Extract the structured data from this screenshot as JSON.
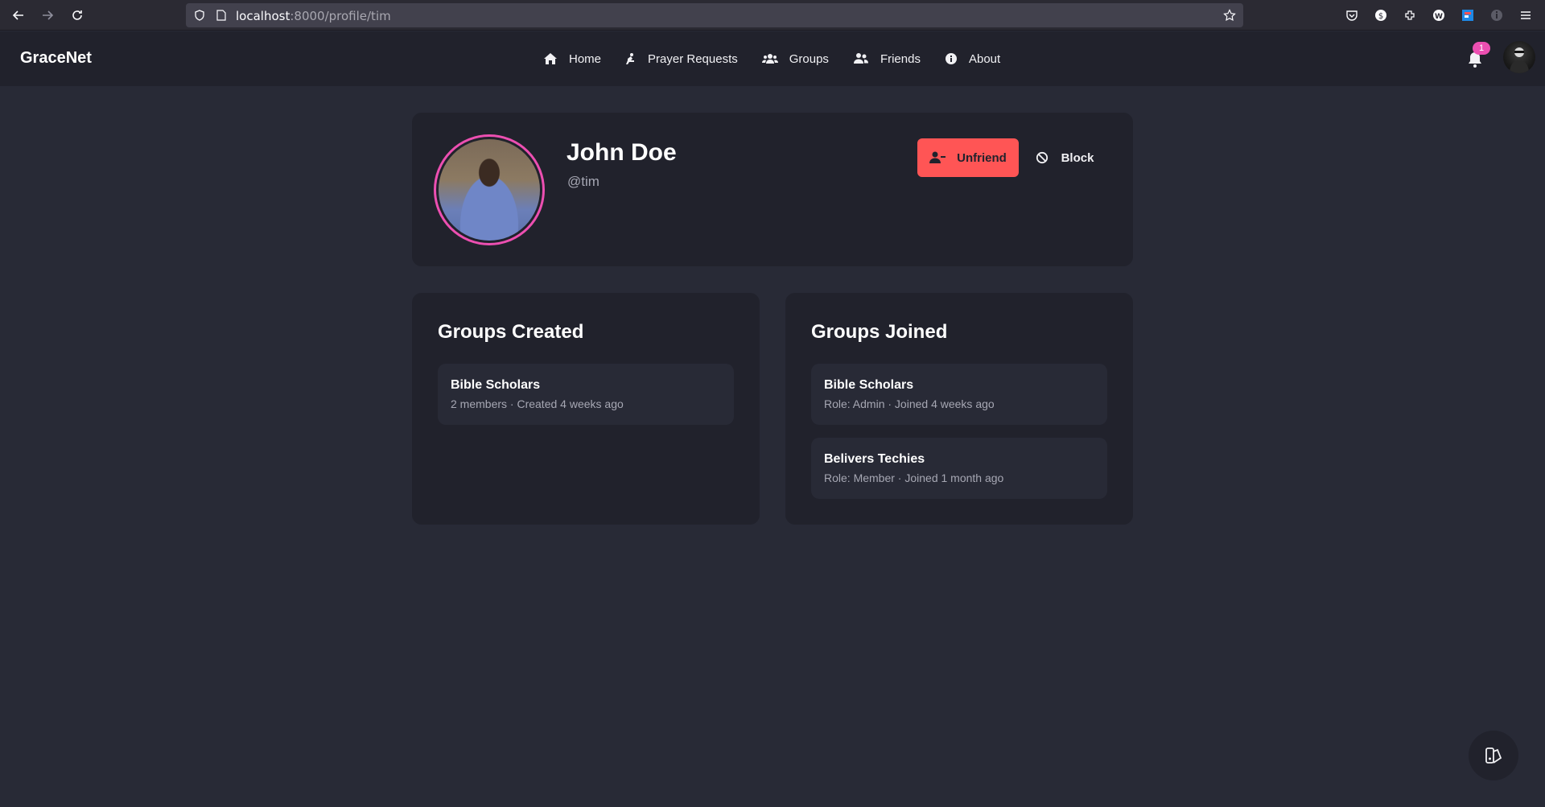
{
  "browser": {
    "url_host": "localhost",
    "url_rest": ":8000/profile/tim"
  },
  "header": {
    "brand": "GraceNet",
    "nav": [
      {
        "label": "Home",
        "icon": "home-icon"
      },
      {
        "label": "Prayer Requests",
        "icon": "praying-icon"
      },
      {
        "label": "Groups",
        "icon": "users-icon"
      },
      {
        "label": "Friends",
        "icon": "user-friends-icon"
      },
      {
        "label": "About",
        "icon": "info-icon"
      }
    ],
    "notification_count": "1"
  },
  "profile": {
    "name": "John Doe",
    "handle": "@tim",
    "unfriend_label": "Unfriend",
    "block_label": "Block"
  },
  "groups_created": {
    "title": "Groups Created",
    "items": [
      {
        "name": "Bible Scholars",
        "meta": "2 members · Created 4 weeks ago"
      }
    ]
  },
  "groups_joined": {
    "title": "Groups Joined",
    "items": [
      {
        "name": "Bible Scholars",
        "meta": "Role: Admin · Joined 4 weeks ago"
      },
      {
        "name": "Belivers Techies",
        "meta": "Role: Member · Joined 1 month ago"
      }
    ]
  },
  "colors": {
    "background": "#282a36",
    "card": "#21222c",
    "accent_pink": "#ec4fb1",
    "danger": "#ff5555"
  }
}
